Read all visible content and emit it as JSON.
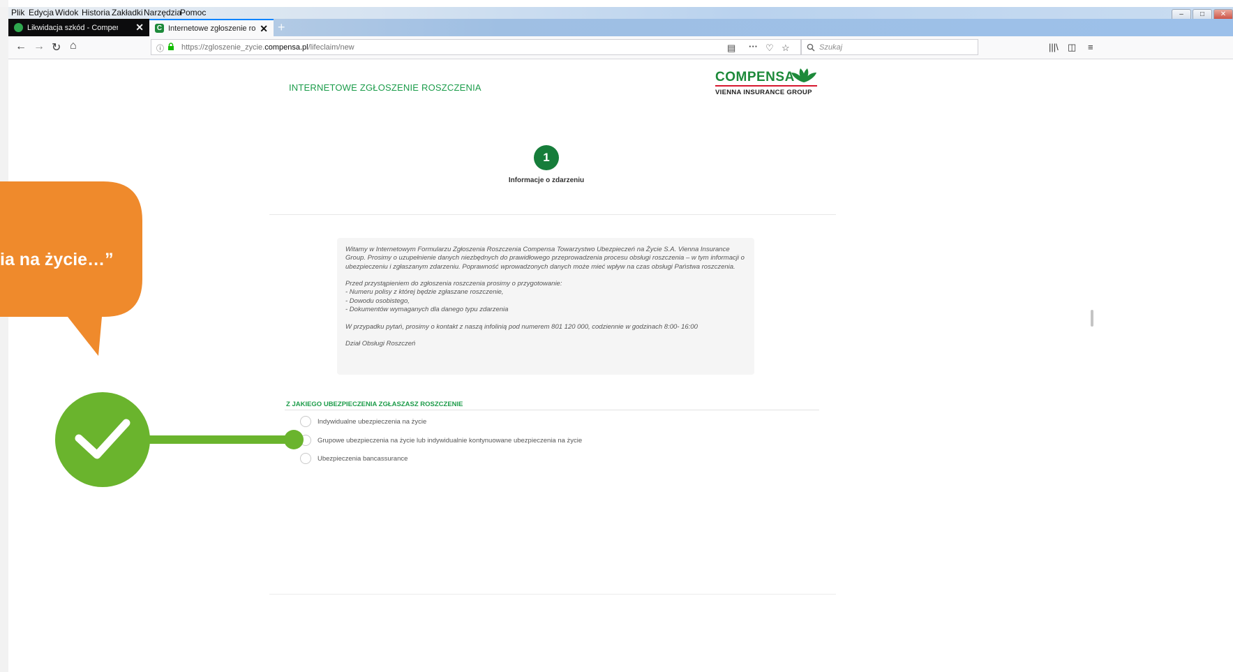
{
  "menu": [
    "Plik",
    "Edycja",
    "Widok",
    "Historia",
    "Zakładki",
    "Narzędzia",
    "Pomoc"
  ],
  "tabs": [
    {
      "label": "Likwidacja szkód - Compensa",
      "close": "✕"
    },
    {
      "label": "Internetowe zgłoszenie roszczenia",
      "close": "✕"
    }
  ],
  "new_tab": "+",
  "url": {
    "prefix": "https://zgloszenie_zycie.",
    "host": "compensa.pl",
    "path": "/lifeclaim/new"
  },
  "search": {
    "placeholder": "Szukaj"
  },
  "page": {
    "title": "INTERNETOWE ZGŁOSZENIE ROSZCZENIA",
    "logo": {
      "name": "COMPENSA",
      "tagline": "VIENNA INSURANCE GROUP"
    },
    "step": {
      "number": "1",
      "label": "Informacje o zdarzeniu"
    },
    "intro": [
      "Witamy w Internetowym Formularzu Zgłoszenia Roszczenia Compensa Towarzystwo Ubezpieczeń na Życie S.A. Vienna Insurance Group. Prosimy o uzupełnienie danych niezbędnych do prawidłowego przeprowadzenia procesu obsługi roszczenia – w tym informacji o ubezpieczeniu i zgłaszanym zdarzeniu. Poprawność wprowadzonych danych może mieć wpływ na czas obsługi Państwa roszczenia.",
      "Przed przystąpieniem do zgłoszenia roszczenia prosimy o przygotowanie:\n- Numeru polisy z której będzie zgłaszane roszczenie,\n- Dowodu osobistego,\n- Dokumentów wymaganych dla danego typu zdarzenia",
      "W przypadku pytań, prosimy o kontakt z naszą infolinią pod numerem 801 120 000, codziennie w godzinach 8:00- 16:00",
      "Dział Obsługi Roszczeń"
    ],
    "section_title": "Z JAKIEGO UBEZPIECZENIA ZGŁASZASZ ROSZCZENIE",
    "options": [
      "Indywidualne ubezpieczenia na życie",
      "Grupowe ubezpieczenia na życie lub indywidualnie kontynuowane ubezpieczenia na życie",
      "Ubezpieczenia bancassurance"
    ]
  },
  "overlay": {
    "bubble_text": "ia na życie…”"
  },
  "colors": {
    "brand_green": "#1b9c4a",
    "step_green": "#167d3a",
    "overlay_green": "#6ab42d",
    "bubble_orange": "#ef8a2c",
    "logo_red": "#d6182e"
  }
}
